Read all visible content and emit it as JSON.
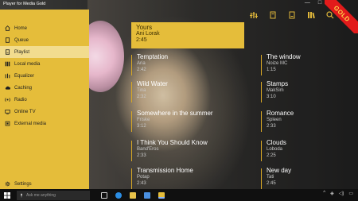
{
  "window": {
    "title": "Player for Media Gold",
    "controls": [
      "—",
      "□",
      "✕"
    ]
  },
  "ribbon": {
    "text": "GOLD",
    "color": "#e21b1b",
    "text_color": "#ffd24a"
  },
  "colors": {
    "accent": "#e5bd3a",
    "accent_active": "#f2dc8e",
    "divider": "#d9a926"
  },
  "toolbar": {
    "icons": [
      "equalizer-icon",
      "queue-icon",
      "playlist-icon",
      "library-icon",
      "search-icon"
    ]
  },
  "sidebar": {
    "items": [
      {
        "label": "Home",
        "icon": "home-icon"
      },
      {
        "label": "Queue",
        "icon": "queue-icon"
      },
      {
        "label": "Playlist",
        "icon": "playlist-icon",
        "active": true
      },
      {
        "label": "Local media",
        "icon": "folder-icon"
      },
      {
        "label": "Equalizer",
        "icon": "equalizer-icon"
      },
      {
        "label": "Caching",
        "icon": "cloud-icon"
      },
      {
        "label": "Radio",
        "icon": "radio-icon"
      },
      {
        "label": "Online TV",
        "icon": "tv-icon"
      },
      {
        "label": "External media",
        "icon": "external-icon"
      }
    ],
    "settings": {
      "label": "Settings",
      "icon": "gear-icon"
    }
  },
  "now_playing": {
    "title": "Yours",
    "artist": "Ani Lorak",
    "time": "2:45"
  },
  "tracks_left": [
    {
      "title": "Temptation",
      "artist": "Aria",
      "time": "2:42"
    },
    {
      "title": "Wild Water",
      "artist": "Tina",
      "time": "2:32"
    },
    {
      "title": "Somewhere in the summer",
      "artist": "Friske",
      "time": "3:12"
    },
    {
      "title": "I Think You Should Know",
      "artist": "Band'Eros",
      "time": "2:33"
    },
    {
      "title": "Transmission Home",
      "artist": "Potap",
      "time": "2:43"
    }
  ],
  "tracks_right": [
    {
      "title": "The window",
      "artist": "Noize MC",
      "time": "1:15"
    },
    {
      "title": "Stamps",
      "artist": "MakSim",
      "time": "3:10"
    },
    {
      "title": "Romance",
      "artist": "Spleen",
      "time": "2:33"
    },
    {
      "title": "Clouds",
      "artist": "Loboda",
      "time": "2:25"
    },
    {
      "title": "New day",
      "artist": "Tati",
      "time": "2:45"
    }
  ],
  "taskbar": {
    "search_placeholder": "Ask me anything",
    "apps": [
      "task-view-icon",
      "edge-icon",
      "explorer-icon",
      "store-icon",
      "player-icon"
    ],
    "app_colors": [
      "#cfcfcf",
      "#2b8de3",
      "#e8c24a",
      "#4a8fe0",
      "#e5bd3a"
    ]
  }
}
